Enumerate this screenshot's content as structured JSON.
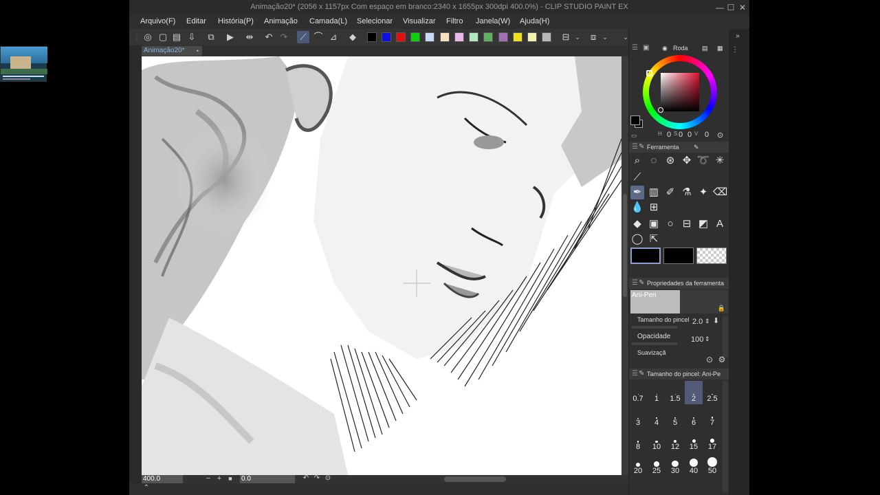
{
  "window": {
    "title": "Animação20* (2056 x 1157px Com espaço em branco:2340 x 1655px 300dpi 400.0%) - CLIP STUDIO PAINT EX",
    "minimize": "—",
    "maximize": "☐",
    "close": "✕"
  },
  "menu": [
    "Arquivo(F)",
    "Editar",
    "História(P)",
    "Animação",
    "Camada(L)",
    "Selecionar",
    "Visualizar",
    "Filtro",
    "Janela(W)",
    "Ajuda(H)"
  ],
  "toolbar": {
    "colors": [
      "#000000",
      "#1010e0",
      "#e01010",
      "#10d010",
      "#c8d8f8",
      "#f8e0c0",
      "#e8b8e8",
      "#b0e8c0",
      "#60b060",
      "#a070b0",
      "#f0e020",
      "#f0f0b0",
      "#b8b8b8"
    ]
  },
  "document": {
    "tab_label": "Animação20*",
    "tab_close": "•"
  },
  "statusbar": {
    "zoom": "400.0",
    "angle": "0.0"
  },
  "color_panel": {
    "title": "Roda",
    "h": "0",
    "s": "0",
    "v": "0",
    "h_label": "H",
    "s_label": "S",
    "v_label": "V"
  },
  "tool_panel": {
    "title": "Ferramenta"
  },
  "tool_properties": {
    "title": "Propriedades da ferramenta",
    "preset_name": "Ani-Pen",
    "brush_size_label": "Tamanho do pincel",
    "brush_size_value": "2.0",
    "opacity_label": "Opacidade",
    "opacity_value": "100",
    "smoothing_label": "Suavizaçã"
  },
  "brush_size_panel": {
    "title": "Tamanho do pincel: Ani-Pe",
    "sizes": [
      "0.7",
      "1",
      "1.5",
      "2",
      "2.5",
      "3",
      "4",
      "5",
      "6",
      "7",
      "8",
      "10",
      "12",
      "15",
      "17",
      "20",
      "25",
      "30",
      "40",
      "50"
    ],
    "selected": "2"
  }
}
